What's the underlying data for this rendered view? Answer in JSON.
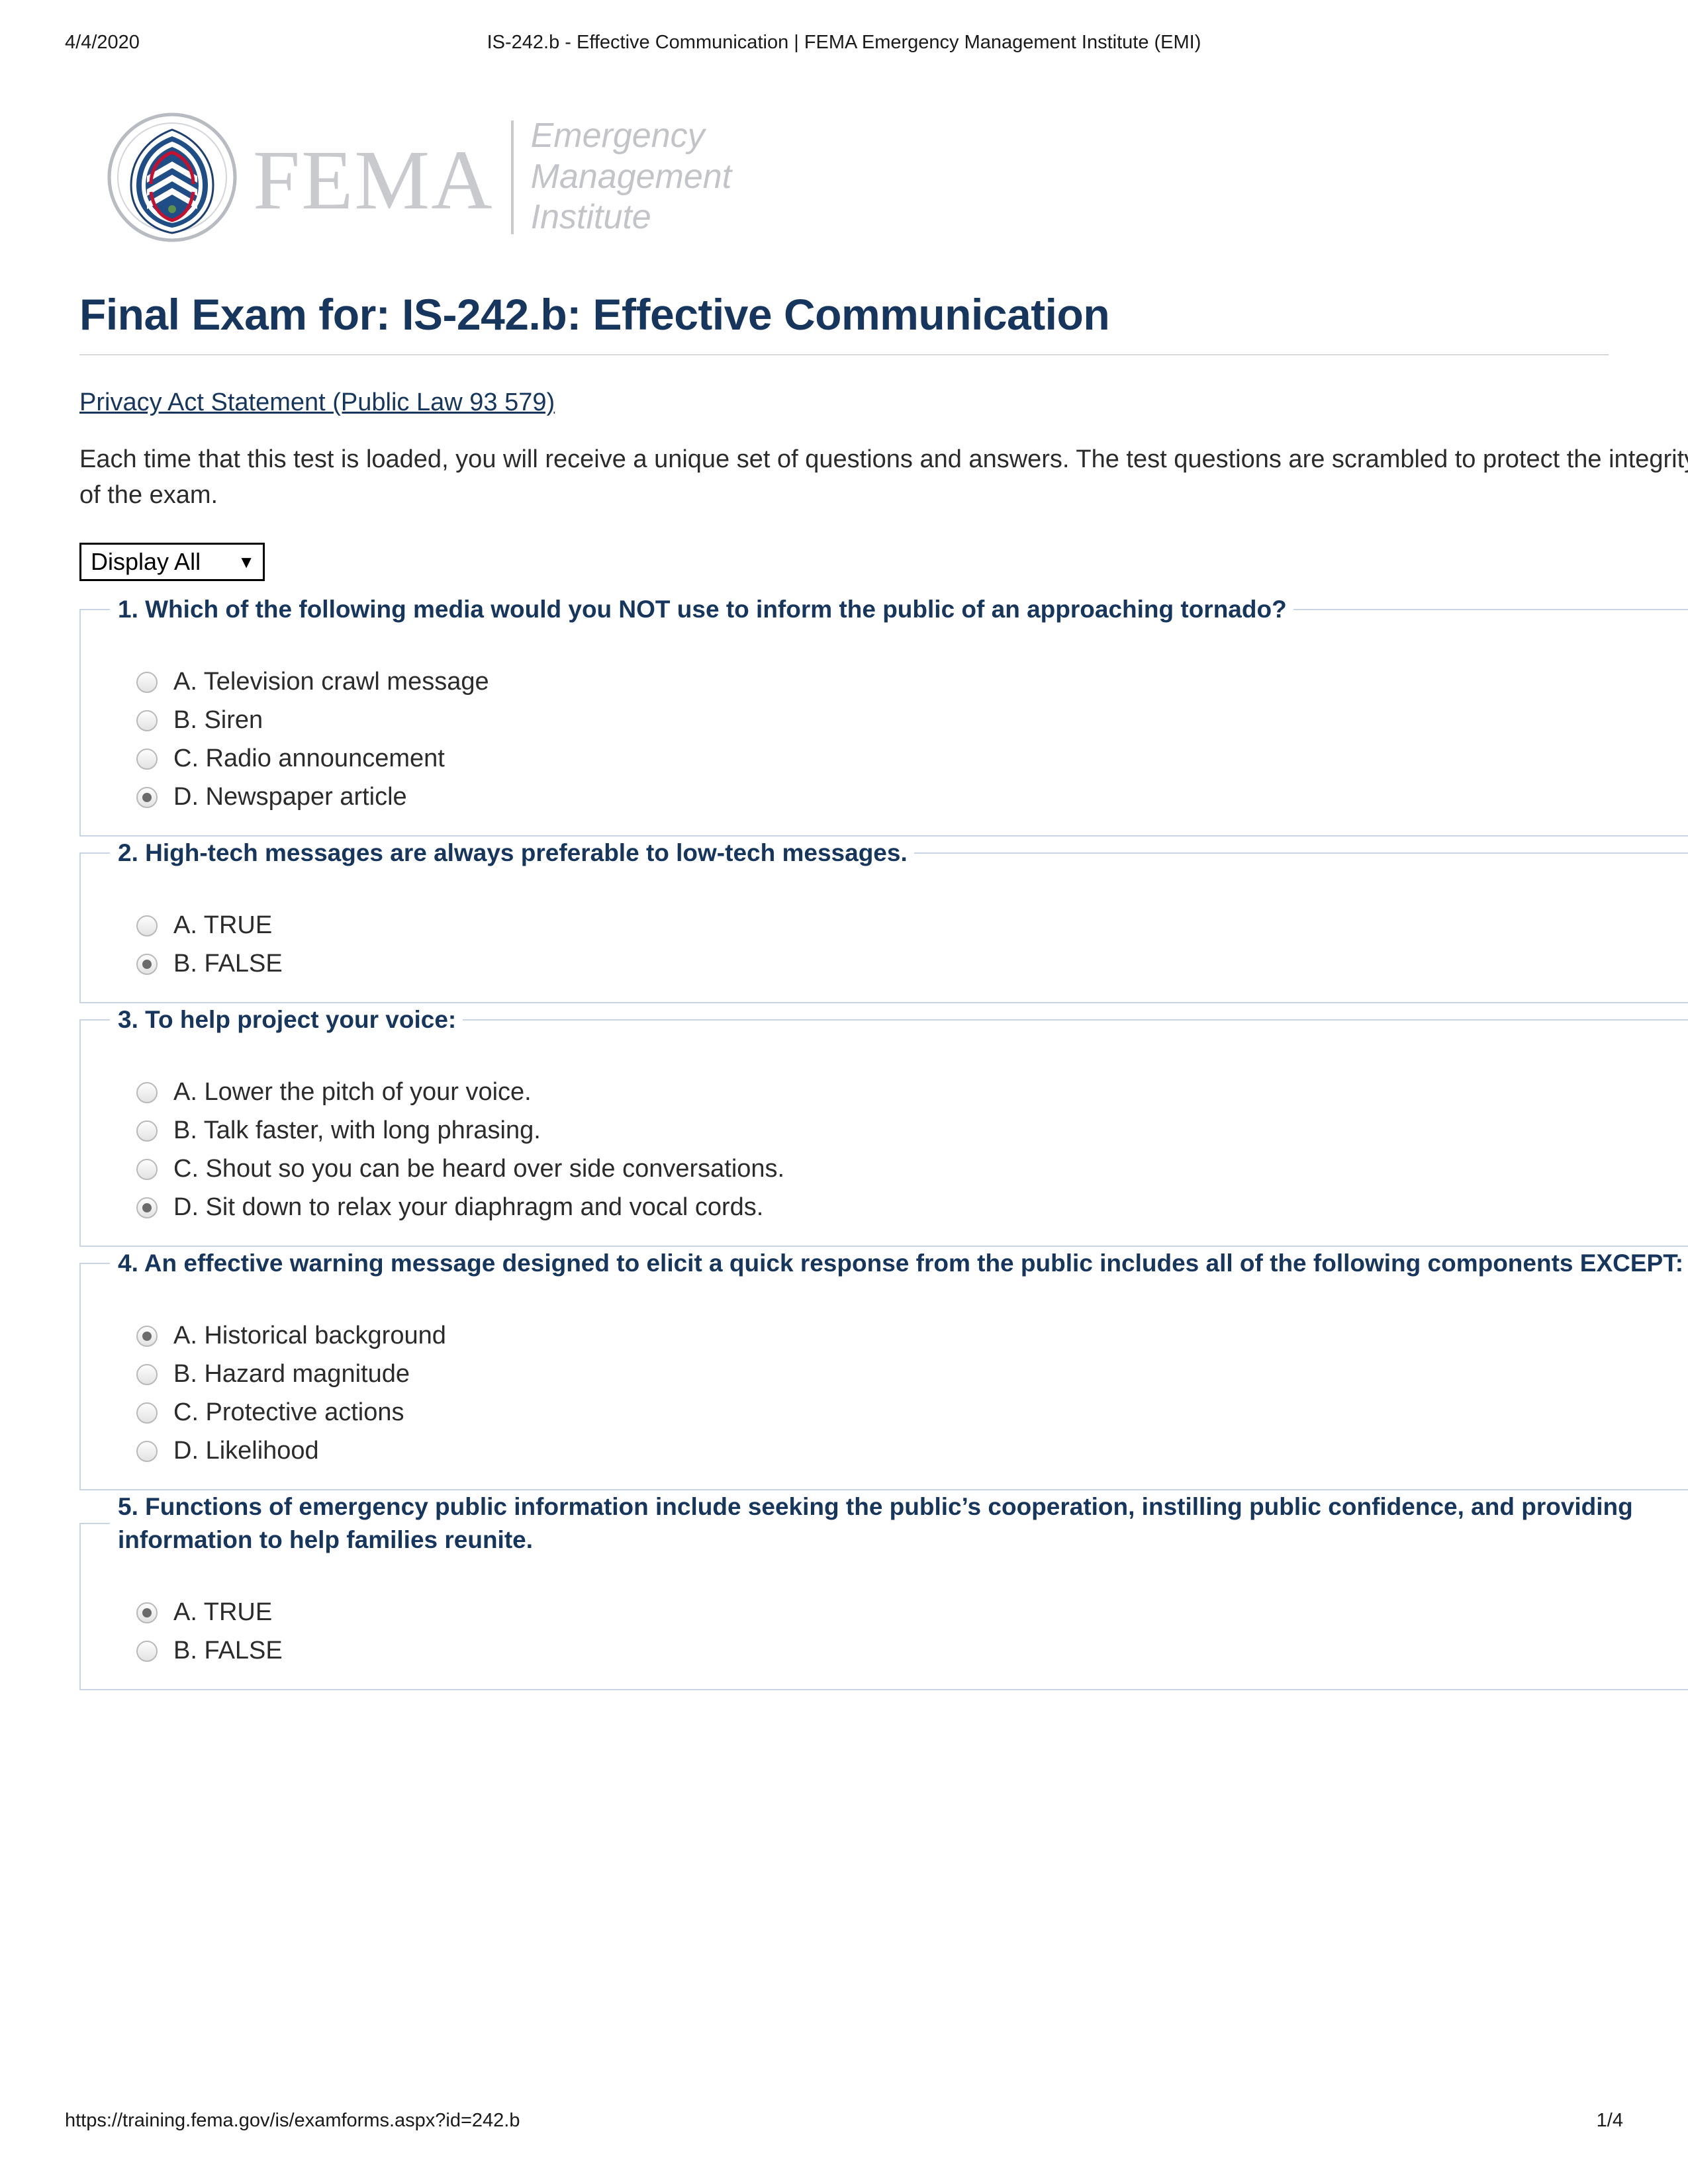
{
  "print_header": {
    "date": "4/4/2020",
    "document_title": "IS-242.b - Effective Communication | FEMA Emergency Management Institute (EMI)"
  },
  "print_footer": {
    "url": "https://training.fema.gov/is/examforms.aspx?id=242.b",
    "page": "1/4"
  },
  "logo": {
    "seal_alt": "dhs-seal-icon",
    "wordmark": "FEMA",
    "line1": "Emergency",
    "line2": "Management",
    "line3": "Institute"
  },
  "page_title": "Final Exam for: IS-242.b: Effective Communication",
  "privacy_link": "Privacy Act Statement (Public Law 93 579)",
  "intro": "Each time that this test is loaded, you will receive a unique set of questions and answers. The test questions are scrambled to protect the integrity of the exam.",
  "display_select": {
    "value": "Display All",
    "caret": "▼",
    "options": [
      "Display All"
    ]
  },
  "colors": {
    "heading_navy": "#17365d",
    "fieldset_border": "#c9d4e4",
    "rule_gray": "#d9d9d9"
  },
  "questions": [
    {
      "number": "1.",
      "text": "1. Which of the following media would you NOT use to inform the public of an approaching tornado?",
      "wrap": false,
      "options": [
        {
          "label": "A. Television crawl message",
          "selected": false
        },
        {
          "label": "B. Siren",
          "selected": false
        },
        {
          "label": "C. Radio announcement",
          "selected": false
        },
        {
          "label": "D. Newspaper article",
          "selected": true
        }
      ]
    },
    {
      "number": "2.",
      "text": "2. High-tech messages are always preferable to low-tech messages.",
      "wrap": false,
      "options": [
        {
          "label": "A. TRUE",
          "selected": false
        },
        {
          "label": "B. FALSE",
          "selected": true
        }
      ]
    },
    {
      "number": "3.",
      "text": "3. To help project your voice:",
      "wrap": false,
      "options": [
        {
          "label": "A. Lower the pitch of your voice.",
          "selected": false
        },
        {
          "label": "B. Talk faster, with long phrasing.",
          "selected": false
        },
        {
          "label": "C. Shout so you can be heard over side conversations.",
          "selected": false
        },
        {
          "label": "D. Sit down to relax your diaphragm and vocal cords.",
          "selected": true
        }
      ]
    },
    {
      "number": "4.",
      "text": "4. An effective warning message designed to elicit a quick response from the public includes all of the following components EXCEPT:",
      "wrap": true,
      "options": [
        {
          "label": "A. Historical background",
          "selected": true
        },
        {
          "label": "B. Hazard magnitude",
          "selected": false
        },
        {
          "label": "C. Protective actions",
          "selected": false
        },
        {
          "label": "D. Likelihood",
          "selected": false
        }
      ]
    },
    {
      "number": "5.",
      "text": "5. Functions of emergency public information include seeking the public’s cooperation, instilling public confidence, and providing information to help families reunite.",
      "wrap": true,
      "options": [
        {
          "label": "A. TRUE",
          "selected": true
        },
        {
          "label": "B. FALSE",
          "selected": false
        }
      ]
    }
  ]
}
